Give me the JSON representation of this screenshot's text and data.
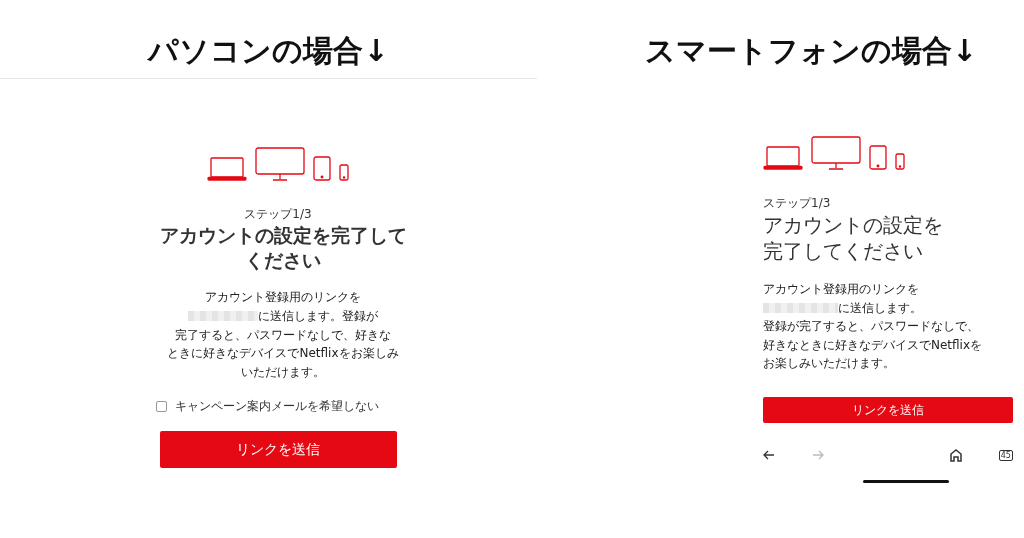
{
  "headings": [
    {
      "text": "パソコンの場合↓"
    },
    {
      "text": "スマートフォンの場合↓"
    }
  ],
  "desktop": {
    "step": "ステップ1/3",
    "title": "アカウントの設定を完了してください",
    "body": [
      {
        "text": "アカウント登録用のリンクを",
        "redacted": false
      },
      {
        "text": "に送信します。登録が",
        "redacted": true
      },
      {
        "text": "完了すると、パスワードなしで、好きな",
        "redacted": false
      },
      {
        "text": "ときに好きなデバイスでNetflixをお楽しみ",
        "redacted": false
      },
      {
        "text": "いただけます。",
        "redacted": false
      }
    ],
    "checkbox": {
      "label": "キャンペーン案内メールを希望しない",
      "checked": false
    },
    "button": "リンクを送信"
  },
  "phone": {
    "step": "ステップ1/3",
    "title": "アカウントの設定を完了してください",
    "body": [
      {
        "text": "アカウント登録用のリンクを",
        "redacted": false
      },
      {
        "text": "に送信します。",
        "redacted": true
      },
      {
        "text": "登録が完了すると、パスワードなしで、",
        "redacted": false
      },
      {
        "text": "好きなときに好きなデバイスでNetflixを",
        "redacted": false
      },
      {
        "text": "お楽しみいただけます。",
        "redacted": false
      }
    ],
    "button": "リンクを送信",
    "nav": [
      {
        "kind": "back",
        "disabled": false
      },
      {
        "kind": "forward",
        "disabled": true
      },
      {
        "kind": "home"
      },
      {
        "kind": "tabs",
        "label": "45"
      }
    ]
  }
}
